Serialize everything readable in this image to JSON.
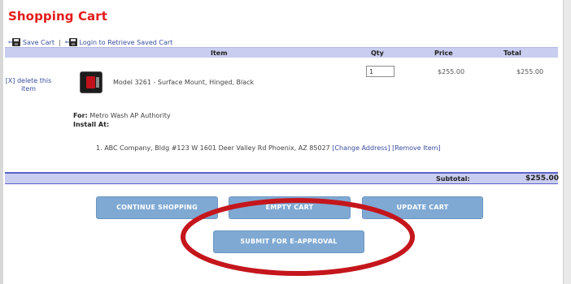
{
  "page": {
    "title": "Shopping Cart"
  },
  "links": {
    "save_cart": "Save Cart",
    "separator": "|",
    "login_retrieve": "Login to Retrieve Saved Cart"
  },
  "table": {
    "headers": {
      "item": "Item",
      "qty": "Qty",
      "price": "Price",
      "total": "Total"
    },
    "rows": [
      {
        "remove_label": "[X] delete this item",
        "description": "Model 3261 - Surface Mount, Hinged, Black",
        "qty": "1",
        "price": "$255.00",
        "total": "$255.00",
        "for_label": "For:",
        "for_value": "Metro Wash AP Authority",
        "install_label": "Install At:",
        "address_index": "1.",
        "address": "ABC Company, Bldg #123 W 1601 Deer Valley Rd Phoenix, AZ 85027",
        "change_address": "[Change Address]",
        "remove_item": "[Remove Item]"
      }
    ]
  },
  "summary": {
    "subtotal_label": "Subtotal:",
    "subtotal_value": "$255.00"
  },
  "buttons": {
    "continue_shopping": "CONTINUE SHOPPING",
    "empty_cart": "EMPTY CART",
    "update_cart": "UPDATE CART",
    "submit_approval": "SUBMIT FOR E-APPROVAL"
  },
  "colors": {
    "title": "#e31b1b",
    "header_bg": "#c9cdef",
    "button_bg": "#7fa9d3",
    "annotation": "#c4161c",
    "link": "#3a4fa0"
  },
  "icons": {
    "save": "floppy-disk-icon",
    "login": "floppy-disk-icon"
  }
}
